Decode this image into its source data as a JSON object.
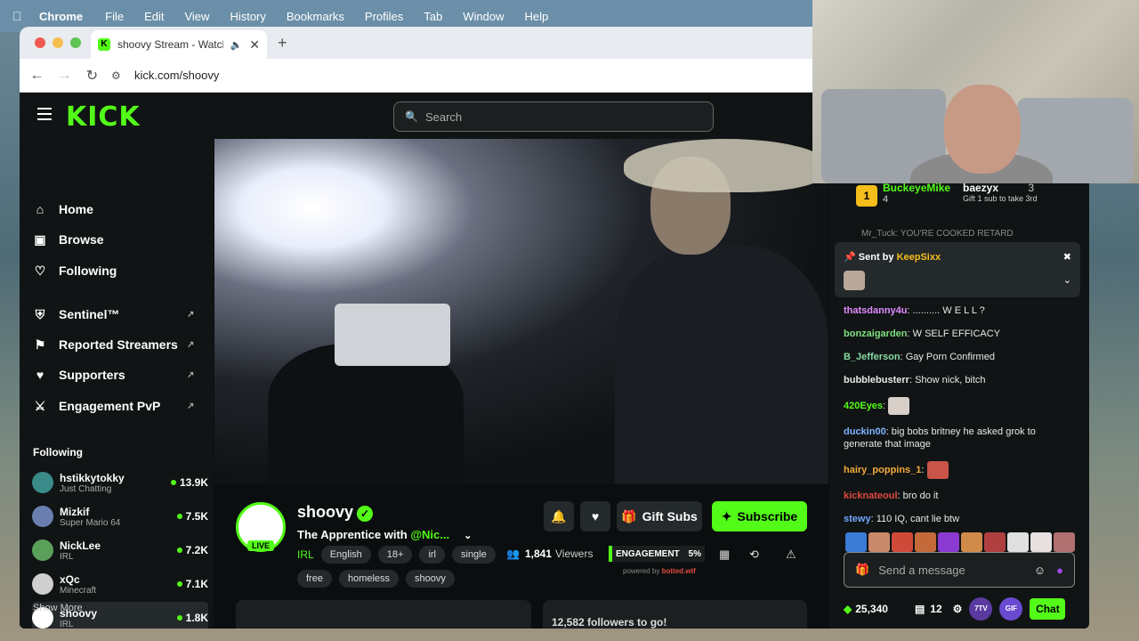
{
  "menubar": {
    "items": [
      "Chrome",
      "File",
      "Edit",
      "View",
      "History",
      "Bookmarks",
      "Profiles",
      "Tab",
      "Window",
      "Help"
    ]
  },
  "browser": {
    "tab_title": "shoovy Stream - Watch Li",
    "url": "kick.com/shoovy"
  },
  "site": {
    "logo": "KICK",
    "search_placeholder": "Search"
  },
  "sidebar": {
    "nav": [
      {
        "label": "Home",
        "icon": "home-icon"
      },
      {
        "label": "Browse",
        "icon": "browse-icon"
      },
      {
        "label": "Following",
        "icon": "heart-icon"
      },
      {
        "label": "Sentinel™",
        "icon": "shield-icon"
      },
      {
        "label": "Reported Streamers",
        "icon": "flag-icon"
      },
      {
        "label": "Supporters",
        "icon": "heart-icon"
      },
      {
        "label": "Engagement PvP",
        "icon": "swords-icon"
      }
    ],
    "following_title": "Following",
    "following": [
      {
        "name": "hstikkytokky",
        "category": "Just Chatting",
        "viewers": "13.9K"
      },
      {
        "name": "Mizkif",
        "category": "Super Mario 64",
        "viewers": "7.5K"
      },
      {
        "name": "NickLee",
        "category": "IRL",
        "viewers": "7.2K"
      },
      {
        "name": "xQc",
        "category": "Minecraft",
        "viewers": "7.1K"
      },
      {
        "name": "shoovy",
        "category": "IRL",
        "viewers": "1.8K"
      }
    ],
    "show_more": "Show More"
  },
  "channel": {
    "name": "shoovy",
    "live": "LIVE",
    "title_prefix": "The Apprentice with ",
    "title_mention": "@Nic...",
    "category": "IRL",
    "tags_row1": [
      "English",
      "18+",
      "irl",
      "single"
    ],
    "tags_row2": [
      "free",
      "homeless",
      "shoovy"
    ],
    "gift_subs": "Gift Subs",
    "subscribe": "Subscribe",
    "viewers": "1,841",
    "viewers_label": "Viewers",
    "engagement_label": "ENGAGEMENT",
    "engagement_value": "5%",
    "powered_by": "powered by ",
    "powered_brand": "botted.wtf",
    "followers_goal": "12,582 followers to go!"
  },
  "chat": {
    "leader1_name": "BuckeyeMike",
    "leader1_count": "4",
    "leader1_rank": "1",
    "leader2_name": "baezyx",
    "leader2_count": "3",
    "leader2_note": "Gift 1 sub to take 3rd",
    "pinned_prefix": "Sent by ",
    "pinned_user": "KeepSixx",
    "partial_line": "Mr_Tuck: YOU'RE COOKED RETARD",
    "messages": [
      {
        "user": "thatsdanny4u",
        "text": " .......... W E L L ?",
        "color": "#e18bff"
      },
      {
        "user": "bonzaigarden",
        "text": " W SELF EFFICACY",
        "color": "#7ee07e"
      },
      {
        "user": "B_Jefferson",
        "text": " Gay Porn Confirmed",
        "color": "#8ad9a3"
      },
      {
        "user": "bubblebusterr",
        "text": " Show nick, bitch",
        "color": "#e8e8e8"
      },
      {
        "user": "420Eyes",
        "text": "",
        "color": "#53fc18"
      },
      {
        "user": "duckin00",
        "text": " big bobs britney he asked grok to generate that image",
        "color": "#7fb3ff"
      },
      {
        "user": "hairy_poppins_1",
        "text": "",
        "color": "#f2a93b"
      },
      {
        "user": "kicknateoul",
        "text": " bro do it",
        "color": "#e0493f"
      },
      {
        "user": "stewy",
        "text": " 110 IQ, cant lie btw",
        "color": "#6ea8ff"
      }
    ],
    "input_placeholder": "Send a message",
    "points": "25,340",
    "count": "12",
    "badge1": "7TV",
    "badge2": "GIF",
    "chat_button": "Chat"
  }
}
